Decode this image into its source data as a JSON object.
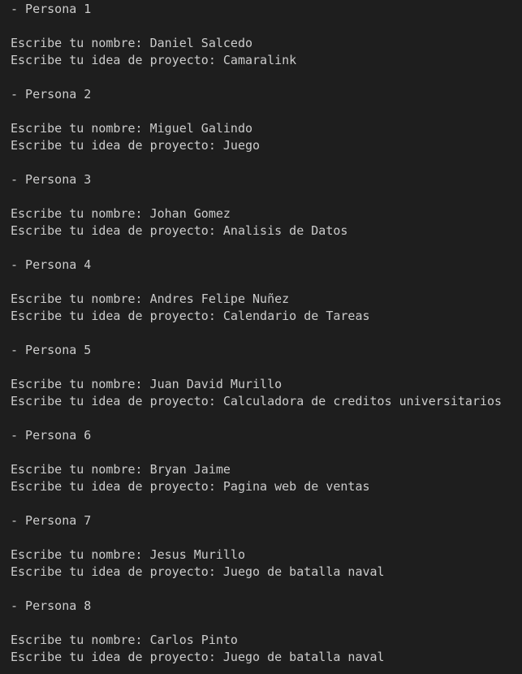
{
  "terminal": {
    "name_prompt": "Escribe tu nombre: ",
    "idea_prompt": "Escribe tu idea de proyecto: ",
    "entries": [
      {
        "header": "- Persona 1",
        "name": "Daniel Salcedo",
        "idea": "Camaralink"
      },
      {
        "header": "- Persona 2",
        "name": "Miguel Galindo",
        "idea": "Juego"
      },
      {
        "header": "- Persona 3",
        "name": "Johan Gomez",
        "idea": "Analisis de Datos"
      },
      {
        "header": "- Persona 4",
        "name": "Andres Felipe Nuñez",
        "idea": "Calendario de Tareas"
      },
      {
        "header": "- Persona 5",
        "name": "Juan David Murillo",
        "idea": "Calculadora de creditos universitarios"
      },
      {
        "header": "- Persona 6",
        "name": "Bryan Jaime",
        "idea": "Pagina web de ventas"
      },
      {
        "header": "- Persona 7",
        "name": "Jesus Murillo",
        "idea": "Juego de batalla naval"
      },
      {
        "header": "- Persona 8",
        "name": "Carlos Pinto",
        "idea": "Juego de batalla naval"
      }
    ]
  }
}
